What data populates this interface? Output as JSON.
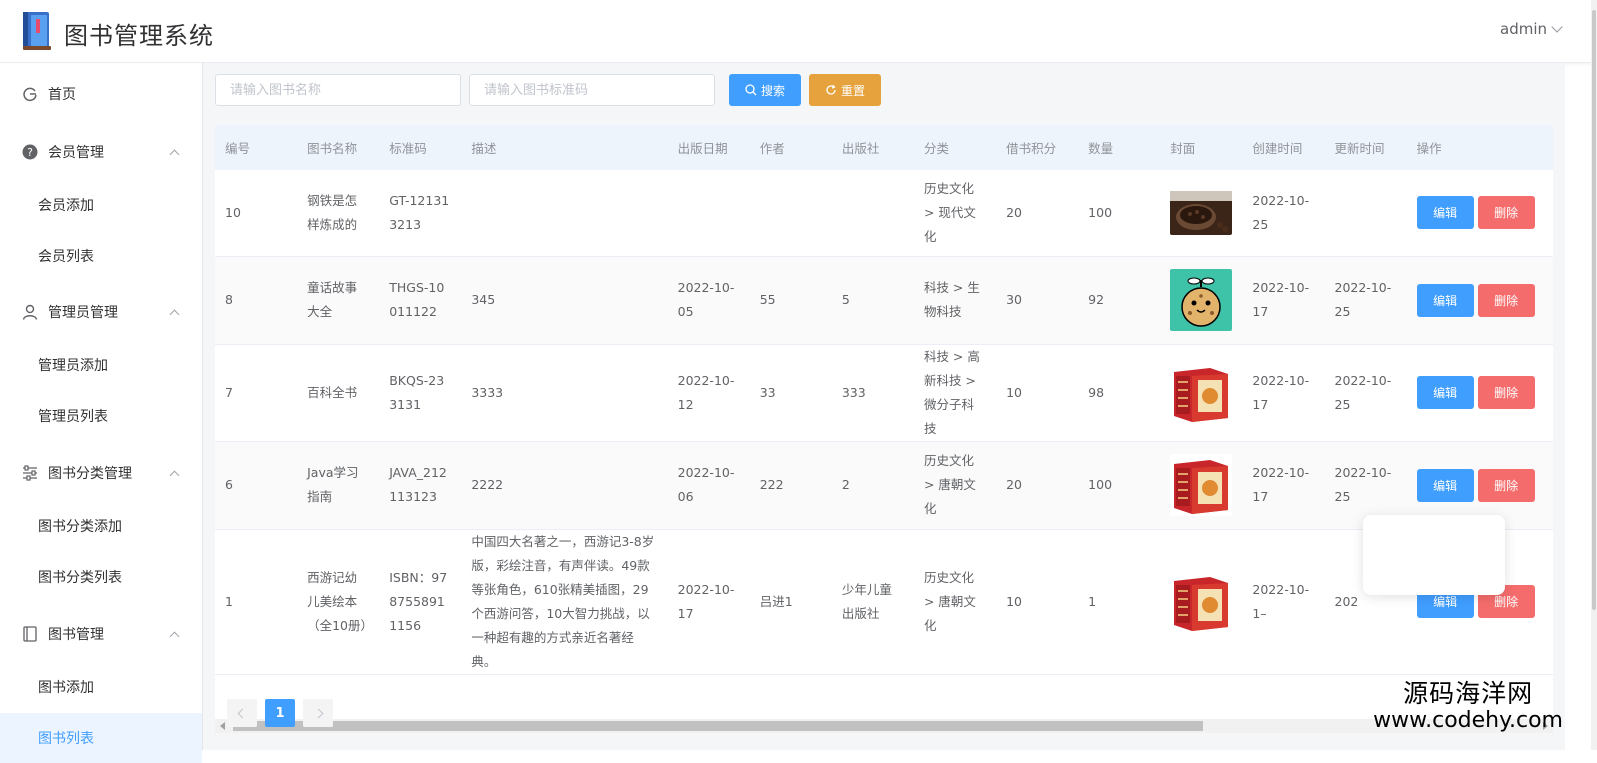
{
  "app": {
    "title": "图书管理系统",
    "user": "admin"
  },
  "sidebar": {
    "home": "首页",
    "groups": [
      {
        "title": "会员管理",
        "icon": "question-circle-icon",
        "items": [
          "会员添加",
          "会员列表"
        ]
      },
      {
        "title": "管理员管理",
        "icon": "user-icon",
        "items": [
          "管理员添加",
          "管理员列表"
        ]
      },
      {
        "title": "图书分类管理",
        "icon": "sliders-icon",
        "items": [
          "图书分类添加",
          "图书分类列表"
        ]
      },
      {
        "title": "图书管理",
        "icon": "notebook-icon",
        "items": [
          "图书添加",
          "图书列表"
        ]
      }
    ]
  },
  "search": {
    "name_placeholder": "请输入图书名称",
    "code_placeholder": "请输入图书标准码",
    "search_label": "搜索",
    "reset_label": "重置"
  },
  "table": {
    "columns": [
      "编号",
      "图书名称",
      "标准码",
      "描述",
      "出版日期",
      "作者",
      "出版社",
      "分类",
      "借书积分",
      "数量",
      "封面",
      "创建时间",
      "更新时间",
      "操作"
    ],
    "edit_label": "编辑",
    "delete_label": "删除",
    "rows": [
      {
        "id": "10",
        "name": "钢铁是怎样炼成的",
        "code": "GT-121313213",
        "desc": "",
        "pub_date": "",
        "author": "",
        "publisher": "",
        "category": "历史文化 > 现代文化",
        "score": "20",
        "count": "100",
        "cover": "coffee-beans-cover",
        "created": "2022-10-25",
        "updated": ""
      },
      {
        "id": "8",
        "name": "童话故事大全",
        "code": "THGS-10011122",
        "desc": "345",
        "pub_date": "2022-10-05",
        "author": "55",
        "publisher": "5",
        "category": "科技 > 生物科技",
        "score": "30",
        "count": "92",
        "cover": "cookie-cartoon-cover",
        "created": "2022-10-17",
        "updated": "2022-10-25"
      },
      {
        "id": "7",
        "name": "百科全书",
        "code": "BKQS-233131",
        "desc": "3333",
        "pub_date": "2022-10-12",
        "author": "33",
        "publisher": "333",
        "category": "科技 > 高新科技 > 微分子科技",
        "score": "10",
        "count": "98",
        "cover": "journey-west-box-cover",
        "created": "2022-10-17",
        "updated": "2022-10-25"
      },
      {
        "id": "6",
        "name": "Java学习指南",
        "code": "JAVA_212113123",
        "desc": "2222",
        "pub_date": "2022-10-06",
        "author": "222",
        "publisher": "2",
        "category": "历史文化 > 唐朝文化",
        "score": "20",
        "count": "100",
        "cover": "journey-west-box-cover",
        "created": "2022-10-17",
        "updated": "2022-10-25"
      },
      {
        "id": "1",
        "name": "西游记幼儿美绘本（全10册）",
        "code": "ISBN：9787558911156",
        "desc": "中国四大名著之一，西游记3-8岁版，彩绘注音，有声伴读。49款等张角色，610张精美插图，29个西游问答，10大智力挑战，以一种超有趣的方式亲近名著经典。",
        "pub_date": "2022-10-17",
        "author": "吕进1",
        "publisher": "少年儿童出版社",
        "category": "历史文化 > 唐朝文化",
        "score": "10",
        "count": "1",
        "cover": "journey-west-box-cover",
        "created": "2022-10-1–",
        "updated": "202"
      }
    ]
  },
  "pagination": {
    "current": "1"
  },
  "watermark": {
    "cn": "源码海洋网",
    "en": "www.codehy.com"
  },
  "colors": {
    "primary": "#409eff",
    "warning": "#e6a23c",
    "danger": "#f56c6c"
  }
}
